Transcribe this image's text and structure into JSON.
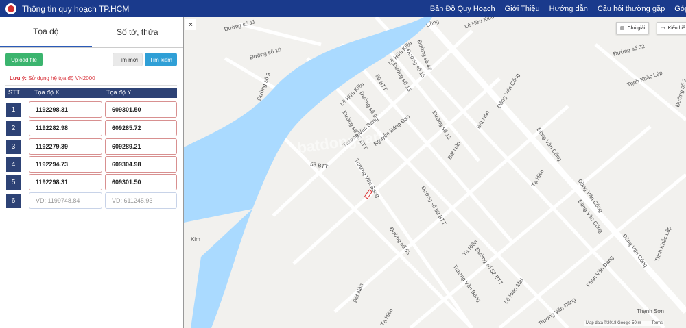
{
  "header": {
    "title": "Thông tin quy hoạch TP.HCM",
    "nav": [
      "Bản Đồ Quy Hoạch",
      "Giới Thiệu",
      "Hướng dẫn",
      "Câu hỏi thường gặp",
      "Góp"
    ]
  },
  "sidebar": {
    "tabs": [
      "Tọa độ",
      "Số tờ, thửa"
    ],
    "upload_label": "Upload file",
    "new_label": "Tìm mới",
    "search_label": "Tìm kiếm",
    "note_prefix": "Lưu ý:",
    "note_text": " Sử dụng hệ tọa độ VN2000",
    "columns": [
      "STT",
      "Tọa độ X",
      "Tọa độ Y"
    ],
    "rows": [
      {
        "stt": "1",
        "x": "1192298.31",
        "y": "609301.50"
      },
      {
        "stt": "2",
        "x": "1192282.98",
        "y": "609285.72"
      },
      {
        "stt": "3",
        "x": "1192279.39",
        "y": "609289.21"
      },
      {
        "stt": "4",
        "x": "1192294.73",
        "y": "609304.98"
      },
      {
        "stt": "5",
        "x": "1192298.31",
        "y": "609301.50"
      },
      {
        "stt": "6",
        "x_placeholder": "VD: 1199748.84",
        "y_placeholder": "VD: 611245.93"
      }
    ]
  },
  "map": {
    "close_label": "×",
    "legend_button": "Chú giải",
    "style_button": "Kiểu hiể",
    "attribution": "Map data ©2018 Google   50 m ⎯⎯⎯⎯   Terms",
    "watermark": "batdongsan",
    "labels": [
      "Đường số 11",
      "Đường số 10",
      "Đường số 9",
      "Lê Hữu Kiều",
      "Đường số 47",
      "Lê Hữu Kiều",
      "Đường số 15",
      "Đường số 13",
      "50 BTT",
      "Đường số 9",
      "Lê Hữu Kiều",
      "Đường số 52 BTT",
      "Nguyễn Đăng Đạo",
      "Bát Nàn",
      "Đường số 13",
      "Bát Nàn",
      "Đồng Văn Cống",
      "Đồng Văn Cống",
      "53 BTT",
      "Trương Văn Bang",
      "Trương Văn Bang",
      "Đường số 52 BTT",
      "Tạ Hiện",
      "Đồng Văn Cống",
      "Đồng Văn Cống",
      "Đồng Văn Cống",
      "Đường số 53",
      "Tạ Hiện",
      "Đường số 52 BTT",
      "Trương Văn Bang",
      "Lê Hiến Mai",
      "Phan Văn Đáng",
      "Bát Nàn",
      "Tạ Hiện",
      "Trương Văn Đăng",
      "Đường số 32",
      "Trịnh Khắc Lập",
      "Trịnh Khắc Lập",
      "Kim",
      "Đường số 2",
      "Thạnh Sơn",
      "Cồng"
    ]
  }
}
